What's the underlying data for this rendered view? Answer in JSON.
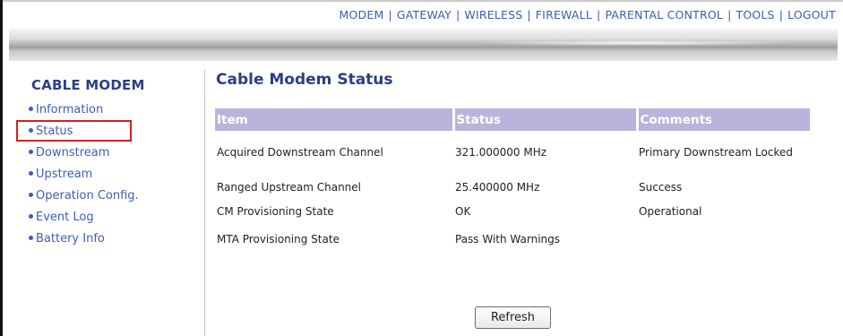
{
  "topnav": {
    "items": [
      "MODEM",
      "GATEWAY",
      "WIRELESS",
      "FIREWALL",
      "PARENTAL CONTROL",
      "TOOLS",
      "LOGOUT"
    ],
    "separator": "|"
  },
  "sidebar": {
    "title": "CABLE MODEM",
    "items": [
      {
        "label": "Information"
      },
      {
        "label": "Status"
      },
      {
        "label": "Downstream"
      },
      {
        "label": "Upstream"
      },
      {
        "label": "Operation Config."
      },
      {
        "label": "Event Log"
      },
      {
        "label": "Battery Info"
      }
    ],
    "active_index": 1
  },
  "main": {
    "title": "Cable Modem Status",
    "table": {
      "headers": [
        "Item",
        "Status",
        "Comments"
      ],
      "rows": [
        [
          "Acquired Downstream Channel",
          "321.000000 MHz",
          "Primary Downstream Locked"
        ],
        [
          "Ranged Upstream Channel",
          "25.400000 MHz",
          "Success"
        ],
        [
          "CM Provisioning State",
          "OK",
          "Operational"
        ],
        [
          "MTA Provisioning State",
          "Pass With Warnings",
          ""
        ]
      ]
    },
    "refresh_label": "Refresh"
  },
  "colors": {
    "link": "#3b5db0",
    "heading": "#2a3f85",
    "table_header_bg": "#b9b4dc",
    "highlight": "#d42020"
  }
}
